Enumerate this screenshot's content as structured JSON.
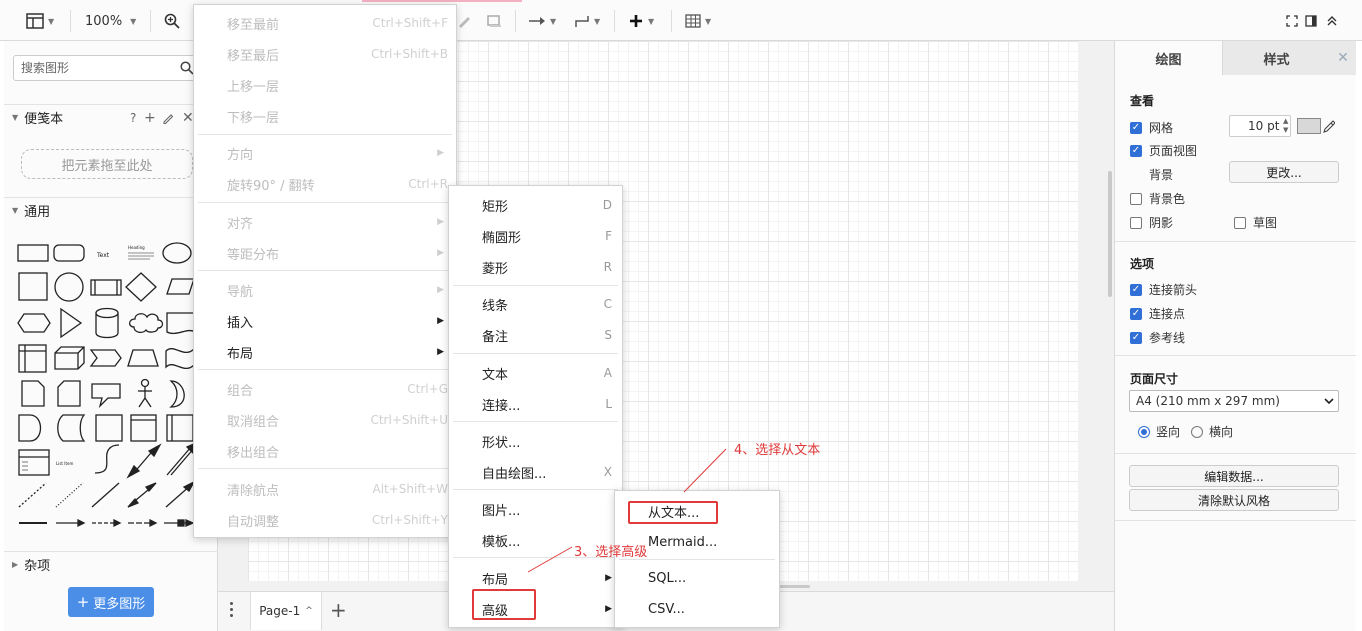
{
  "toolbar": {
    "zoom": "100%"
  },
  "sidebar": {
    "search_placeholder": "搜索图形",
    "scratchpad_title": "便笺本",
    "scratchpad_help": "?",
    "scratchpad_drop": "把元素拖至此处",
    "general_title": "通用",
    "misc_title": "杂项",
    "more_shapes": "更多图形",
    "shape_text_label": "Text",
    "shape_heading_label": "Heading",
    "shape_list_label": "List Item"
  },
  "context_menu": {
    "items": [
      {
        "label": "移至最前",
        "shortcut": "Ctrl+Shift+F"
      },
      {
        "label": "移至最后",
        "shortcut": "Ctrl+Shift+B"
      },
      {
        "label": "上移一层",
        "shortcut": ""
      },
      {
        "label": "下移一层",
        "shortcut": ""
      },
      {
        "label": "方向",
        "shortcut": ""
      },
      {
        "label": "旋转90° / 翻转",
        "shortcut": "Ctrl+R"
      },
      {
        "label": "对齐",
        "shortcut": ""
      },
      {
        "label": "等距分布",
        "shortcut": ""
      },
      {
        "label": "导航",
        "shortcut": ""
      },
      {
        "label": "插入",
        "shortcut": ""
      },
      {
        "label": "布局",
        "shortcut": ""
      },
      {
        "label": "组合",
        "shortcut": "Ctrl+G"
      },
      {
        "label": "取消组合",
        "shortcut": "Ctrl+Shift+U"
      },
      {
        "label": "移出组合",
        "shortcut": ""
      },
      {
        "label": "清除航点",
        "shortcut": "Alt+Shift+W"
      },
      {
        "label": "自动调整",
        "shortcut": "Ctrl+Shift+Y"
      }
    ]
  },
  "insert_menu": {
    "items": [
      {
        "label": "矩形",
        "shortcut": "D"
      },
      {
        "label": "椭圆形",
        "shortcut": "F"
      },
      {
        "label": "菱形",
        "shortcut": "R"
      },
      {
        "label": "线条",
        "shortcut": "C"
      },
      {
        "label": "备注",
        "shortcut": "S"
      },
      {
        "label": "文本",
        "shortcut": "A"
      },
      {
        "label": "连接...",
        "shortcut": "L"
      },
      {
        "label": "形状...",
        "shortcut": ""
      },
      {
        "label": "自由绘图...",
        "shortcut": "X"
      },
      {
        "label": "图片...",
        "shortcut": ""
      },
      {
        "label": "模板...",
        "shortcut": ""
      },
      {
        "label": "布局",
        "shortcut": ""
      },
      {
        "label": "高级",
        "shortcut": ""
      }
    ]
  },
  "advanced_menu": {
    "items": [
      {
        "label": "从文本..."
      },
      {
        "label": "Mermaid..."
      },
      {
        "label": "SQL..."
      },
      {
        "label": "CSV..."
      }
    ]
  },
  "annotations": {
    "step3": "3、选择高级",
    "step4": "4、选择从文本"
  },
  "format_panel": {
    "tab_diagram": "绘图",
    "tab_style": "样式",
    "view_title": "查看",
    "grid_label": "网格",
    "grid_size": "10 pt",
    "page_view_label": "页面视图",
    "background_label": "背景",
    "change_button": "更改...",
    "bg_color_label": "背景色",
    "shadow_label": "阴影",
    "sketch_label": "草图",
    "options_title": "选项",
    "connection_arrows_label": "连接箭头",
    "connection_points_label": "连接点",
    "guides_label": "参考线",
    "paper_size_title": "页面尺寸",
    "paper_size_value": "A4 (210 mm x 297 mm)",
    "portrait_label": "竖向",
    "landscape_label": "横向",
    "edit_data_button": "编辑数据...",
    "clear_style_button": "清除默认风格"
  },
  "pagebar": {
    "page_tab": "Page-1"
  },
  "colors": {
    "accent_blue": "#2f6fd6",
    "annotation_red": "#e03a3a",
    "more_shapes_button": "#4a8ee8"
  }
}
